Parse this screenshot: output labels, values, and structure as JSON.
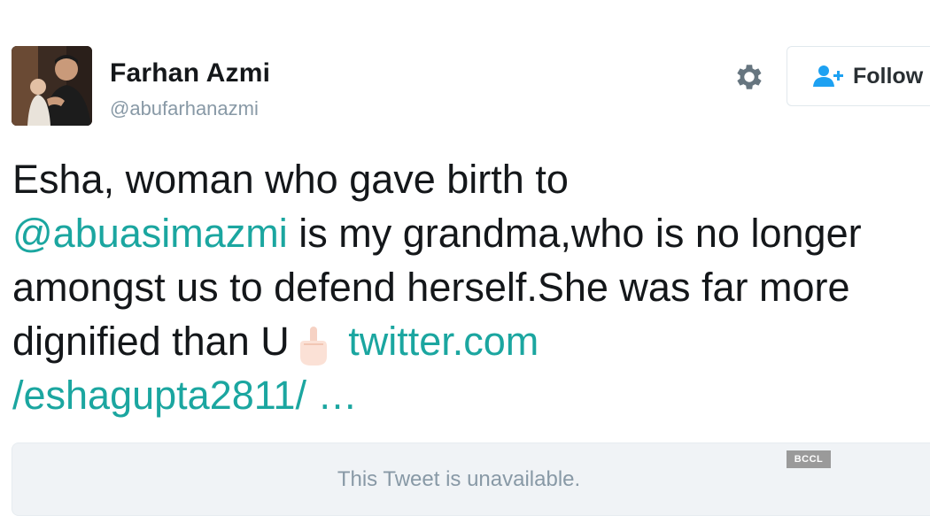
{
  "user": {
    "display_name": "Farhan Azmi",
    "handle": "@abufarhanazmi",
    "avatar_icon": "profile-photo"
  },
  "actions": {
    "settings_icon": "gear-icon",
    "follow_label": "Follow",
    "follow_icon": "add-user-icon"
  },
  "tweet": {
    "text_1": "Esha, woman who gave birth to",
    "mention": "@abuasimazmi",
    "text_2": " is my grandma,who is no longer amongst us to defend herself.She was far more dignified than U",
    "emoji": "middle-finger-emoji",
    "link_1": "twitter.com",
    "link_2": "/eshagupta2811/ …"
  },
  "embedded": {
    "unavailable_text": "This Tweet is unavailable."
  },
  "watermark": {
    "text": "BCCL"
  },
  "colors": {
    "link": "#1ba6a0",
    "follow_icon": "#1da1f2",
    "muted": "#8899a6",
    "card_bg": "#f0f3f6"
  }
}
